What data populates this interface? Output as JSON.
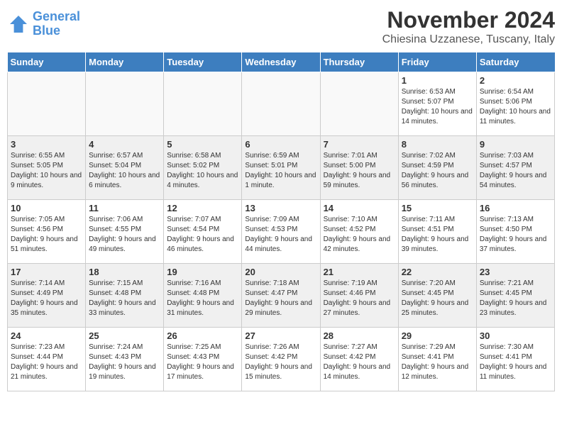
{
  "header": {
    "logo_line1": "General",
    "logo_line2": "Blue",
    "month": "November 2024",
    "location": "Chiesina Uzzanese, Tuscany, Italy"
  },
  "weekdays": [
    "Sunday",
    "Monday",
    "Tuesday",
    "Wednesday",
    "Thursday",
    "Friday",
    "Saturday"
  ],
  "weeks": [
    [
      {
        "day": "",
        "info": ""
      },
      {
        "day": "",
        "info": ""
      },
      {
        "day": "",
        "info": ""
      },
      {
        "day": "",
        "info": ""
      },
      {
        "day": "",
        "info": ""
      },
      {
        "day": "1",
        "info": "Sunrise: 6:53 AM\nSunset: 5:07 PM\nDaylight: 10 hours and 14 minutes."
      },
      {
        "day": "2",
        "info": "Sunrise: 6:54 AM\nSunset: 5:06 PM\nDaylight: 10 hours and 11 minutes."
      }
    ],
    [
      {
        "day": "3",
        "info": "Sunrise: 6:55 AM\nSunset: 5:05 PM\nDaylight: 10 hours and 9 minutes."
      },
      {
        "day": "4",
        "info": "Sunrise: 6:57 AM\nSunset: 5:04 PM\nDaylight: 10 hours and 6 minutes."
      },
      {
        "day": "5",
        "info": "Sunrise: 6:58 AM\nSunset: 5:02 PM\nDaylight: 10 hours and 4 minutes."
      },
      {
        "day": "6",
        "info": "Sunrise: 6:59 AM\nSunset: 5:01 PM\nDaylight: 10 hours and 1 minute."
      },
      {
        "day": "7",
        "info": "Sunrise: 7:01 AM\nSunset: 5:00 PM\nDaylight: 9 hours and 59 minutes."
      },
      {
        "day": "8",
        "info": "Sunrise: 7:02 AM\nSunset: 4:59 PM\nDaylight: 9 hours and 56 minutes."
      },
      {
        "day": "9",
        "info": "Sunrise: 7:03 AM\nSunset: 4:57 PM\nDaylight: 9 hours and 54 minutes."
      }
    ],
    [
      {
        "day": "10",
        "info": "Sunrise: 7:05 AM\nSunset: 4:56 PM\nDaylight: 9 hours and 51 minutes."
      },
      {
        "day": "11",
        "info": "Sunrise: 7:06 AM\nSunset: 4:55 PM\nDaylight: 9 hours and 49 minutes."
      },
      {
        "day": "12",
        "info": "Sunrise: 7:07 AM\nSunset: 4:54 PM\nDaylight: 9 hours and 46 minutes."
      },
      {
        "day": "13",
        "info": "Sunrise: 7:09 AM\nSunset: 4:53 PM\nDaylight: 9 hours and 44 minutes."
      },
      {
        "day": "14",
        "info": "Sunrise: 7:10 AM\nSunset: 4:52 PM\nDaylight: 9 hours and 42 minutes."
      },
      {
        "day": "15",
        "info": "Sunrise: 7:11 AM\nSunset: 4:51 PM\nDaylight: 9 hours and 39 minutes."
      },
      {
        "day": "16",
        "info": "Sunrise: 7:13 AM\nSunset: 4:50 PM\nDaylight: 9 hours and 37 minutes."
      }
    ],
    [
      {
        "day": "17",
        "info": "Sunrise: 7:14 AM\nSunset: 4:49 PM\nDaylight: 9 hours and 35 minutes."
      },
      {
        "day": "18",
        "info": "Sunrise: 7:15 AM\nSunset: 4:48 PM\nDaylight: 9 hours and 33 minutes."
      },
      {
        "day": "19",
        "info": "Sunrise: 7:16 AM\nSunset: 4:48 PM\nDaylight: 9 hours and 31 minutes."
      },
      {
        "day": "20",
        "info": "Sunrise: 7:18 AM\nSunset: 4:47 PM\nDaylight: 9 hours and 29 minutes."
      },
      {
        "day": "21",
        "info": "Sunrise: 7:19 AM\nSunset: 4:46 PM\nDaylight: 9 hours and 27 minutes."
      },
      {
        "day": "22",
        "info": "Sunrise: 7:20 AM\nSunset: 4:45 PM\nDaylight: 9 hours and 25 minutes."
      },
      {
        "day": "23",
        "info": "Sunrise: 7:21 AM\nSunset: 4:45 PM\nDaylight: 9 hours and 23 minutes."
      }
    ],
    [
      {
        "day": "24",
        "info": "Sunrise: 7:23 AM\nSunset: 4:44 PM\nDaylight: 9 hours and 21 minutes."
      },
      {
        "day": "25",
        "info": "Sunrise: 7:24 AM\nSunset: 4:43 PM\nDaylight: 9 hours and 19 minutes."
      },
      {
        "day": "26",
        "info": "Sunrise: 7:25 AM\nSunset: 4:43 PM\nDaylight: 9 hours and 17 minutes."
      },
      {
        "day": "27",
        "info": "Sunrise: 7:26 AM\nSunset: 4:42 PM\nDaylight: 9 hours and 15 minutes."
      },
      {
        "day": "28",
        "info": "Sunrise: 7:27 AM\nSunset: 4:42 PM\nDaylight: 9 hours and 14 minutes."
      },
      {
        "day": "29",
        "info": "Sunrise: 7:29 AM\nSunset: 4:41 PM\nDaylight: 9 hours and 12 minutes."
      },
      {
        "day": "30",
        "info": "Sunrise: 7:30 AM\nSunset: 4:41 PM\nDaylight: 9 hours and 11 minutes."
      }
    ]
  ]
}
